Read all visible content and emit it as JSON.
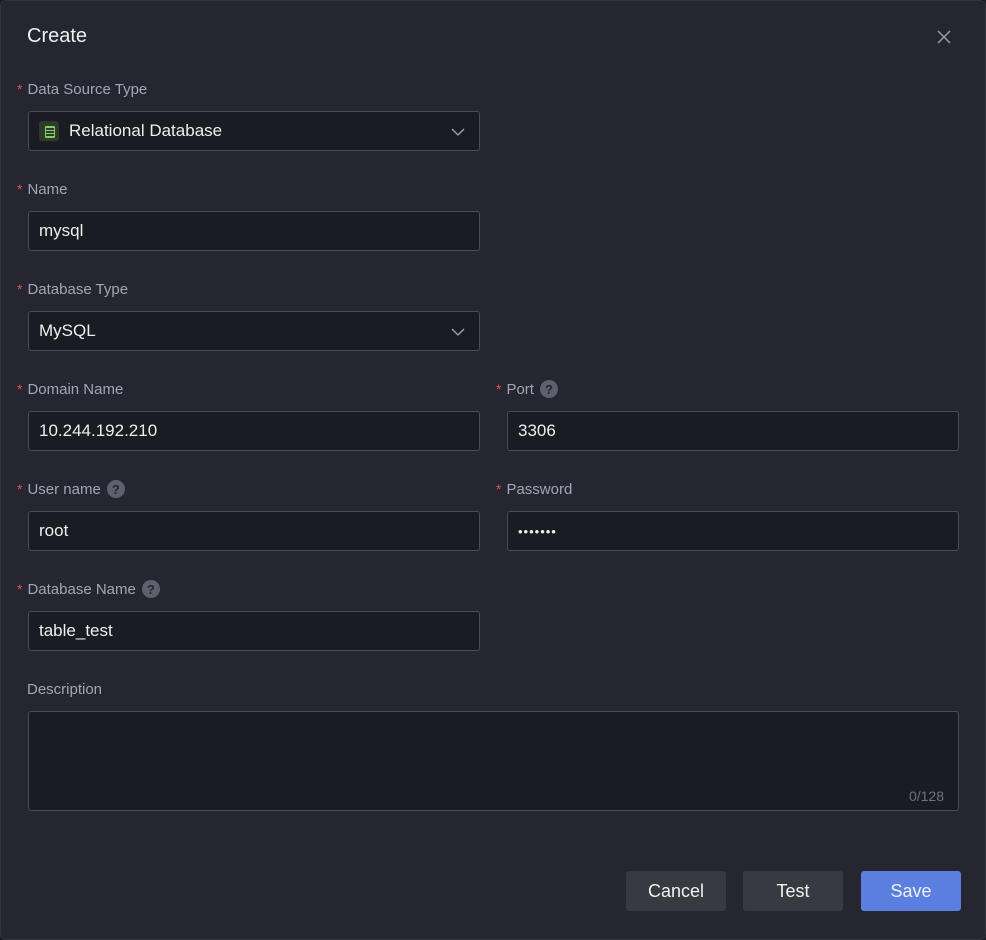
{
  "dialog": {
    "title": "Create",
    "close_icon": "close-icon"
  },
  "required_mark": "*",
  "fields": {
    "data_source_type": {
      "label": "Data Source Type",
      "value": "Relational Database",
      "icon": "database-icon"
    },
    "name": {
      "label": "Name",
      "value": "mysql"
    },
    "database_type": {
      "label": "Database Type",
      "value": "MySQL"
    },
    "domain_name": {
      "label": "Domain Name",
      "value": "10.244.192.210"
    },
    "port": {
      "label": "Port",
      "value": "3306",
      "help": "?"
    },
    "user_name": {
      "label": "User name",
      "value": "root",
      "help": "?"
    },
    "password": {
      "label": "Password",
      "value": "•••••••"
    },
    "database_name": {
      "label": "Database Name",
      "value": "table_test",
      "help": "?"
    },
    "description": {
      "label": "Description",
      "value": "",
      "counter": "0/128"
    }
  },
  "buttons": {
    "cancel": "Cancel",
    "test": "Test",
    "save": "Save"
  },
  "colors": {
    "background": "#25262f",
    "input_bg": "#1b1c23",
    "required": "#e45256",
    "primary": "#5b7fe0"
  }
}
